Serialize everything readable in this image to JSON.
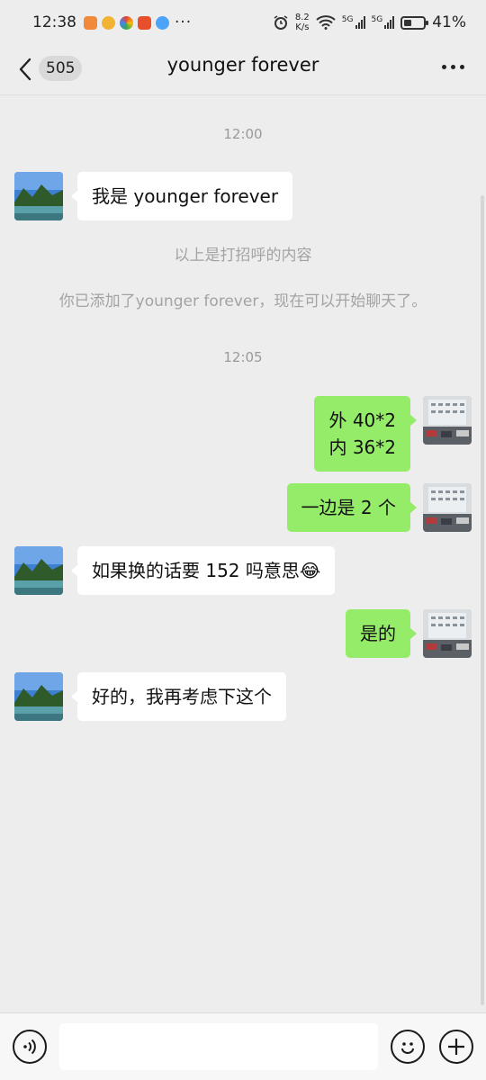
{
  "status_bar": {
    "time": "12:38",
    "more": "···",
    "net_speed_value": "8.2",
    "net_speed_unit": "K/s",
    "signal1_label": "5G",
    "signal2_label": "5G",
    "battery_percent": "41%",
    "battery_level": 0.41
  },
  "header": {
    "unread_count": "505",
    "title": "younger forever"
  },
  "chat": {
    "timestamp_1": "12:00",
    "greeting_message": "我是 younger forever",
    "system_notice_1": "以上是打招呼的内容",
    "system_notice_2": "你已添加了younger forever，现在可以开始聊天了。",
    "timestamp_2": "12:05",
    "out_message_1_line1": "外 40*2",
    "out_message_1_line2": "内 36*2",
    "out_message_2": "一边是 2 个",
    "in_message_2": "如果换的话要 152 吗意思",
    "in_message_2_emoji": "😂",
    "out_message_3": "是的",
    "in_message_3": "好的，我再考虑下这个"
  },
  "colors": {
    "background": "#ededed",
    "outgoing_bubble": "#95ec69",
    "incoming_bubble": "#ffffff"
  },
  "input_bar": {
    "voice_icon": "voice-icon",
    "emoji_icon": "emoji-icon",
    "add_icon": "plus-icon",
    "value": ""
  }
}
